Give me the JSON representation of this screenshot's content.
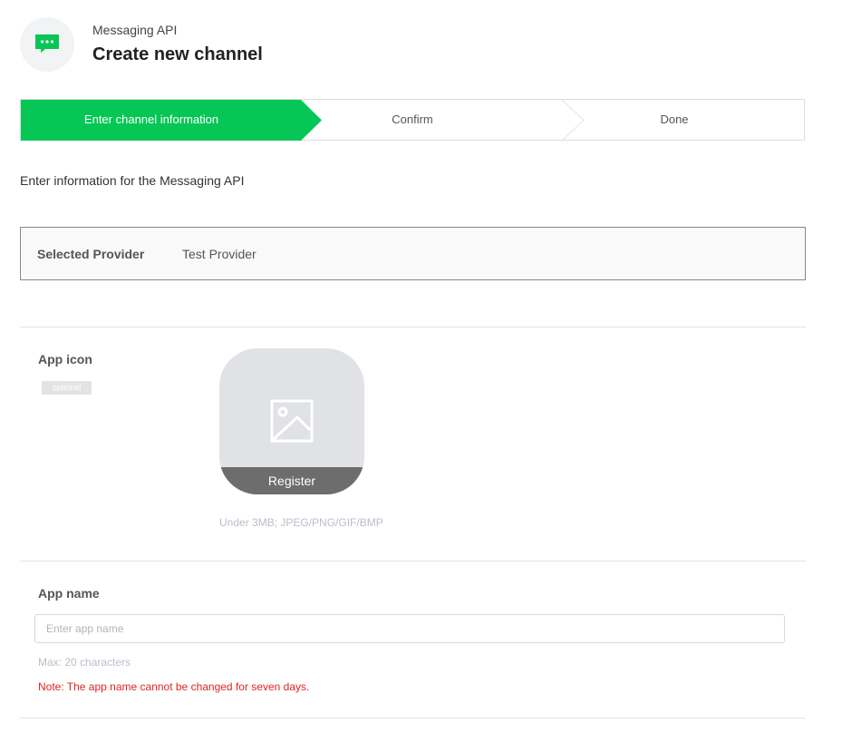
{
  "header": {
    "product": "Messaging API",
    "title": "Create new channel",
    "icon": "chat-bubble-icon",
    "accent_color": "#06c755"
  },
  "steps": {
    "items": [
      {
        "label": "Enter channel information",
        "active": true
      },
      {
        "label": "Confirm",
        "active": false
      },
      {
        "label": "Done",
        "active": false
      }
    ],
    "active_color": "#06c755"
  },
  "intro": "Enter information for the Messaging API",
  "provider": {
    "label": "Selected Provider",
    "value": "Test Provider"
  },
  "app_icon": {
    "label": "App icon",
    "badge": "optional",
    "register_label": "Register",
    "hint": "Under 3MB; JPEG/PNG/GIF/BMP",
    "placeholder_icon": "image-icon"
  },
  "app_name": {
    "label": "App name",
    "value": "",
    "placeholder": "Enter app name",
    "max_hint": "Max: 20 characters",
    "note": "Note: The app name cannot be changed for seven days.",
    "note_color": "#e02424"
  }
}
